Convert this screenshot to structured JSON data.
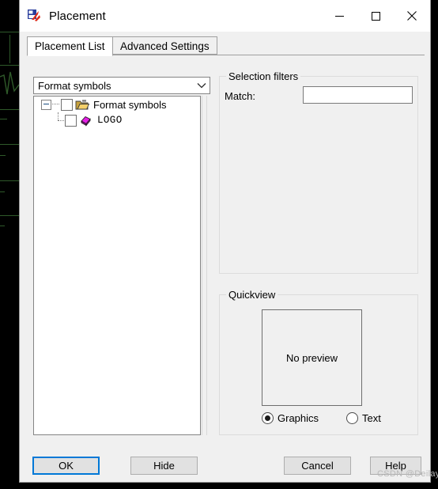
{
  "window": {
    "title": "Placement",
    "icon": "placement-app-icon",
    "controls": {
      "minimize": "minimize-icon",
      "maximize": "maximize-icon",
      "close": "close-icon"
    }
  },
  "tabs": [
    {
      "label": "Placement List",
      "active": true
    },
    {
      "label": "Advanced Settings",
      "active": false
    }
  ],
  "left_panel": {
    "combo": {
      "value": "Format symbols",
      "arrow_icon": "chevron-down-icon"
    },
    "tree": [
      {
        "label": "Format symbols",
        "level": 0,
        "icon": "open-folder-icon",
        "checked": false,
        "expanded": true
      },
      {
        "label": "LOGO",
        "level": 1,
        "icon": "magenta-diamond-icon",
        "checked": false,
        "expanded": null
      }
    ]
  },
  "selection_filters": {
    "title": "Selection filters",
    "match_label": "Match:",
    "match_value": "",
    "match_placeholder": ""
  },
  "quickview": {
    "title": "Quickview",
    "preview_text": "No preview",
    "options": [
      {
        "label": "Graphics",
        "selected": true
      },
      {
        "label": "Text",
        "selected": false
      }
    ]
  },
  "footer": {
    "buttons": [
      {
        "label": "OK",
        "id": "btn-ok",
        "default": true
      },
      {
        "label": "Hide",
        "id": "btn-hide",
        "default": false
      },
      {
        "label": "Cancel",
        "id": "btn-cancel",
        "default": false
      },
      {
        "label": "Help",
        "id": "btn-help",
        "default": false
      }
    ]
  },
  "watermark": "CSDN @Deilay",
  "colors": {
    "accent": "#0078d7",
    "dialog_bg": "#f0f0f0",
    "titlebar_bg": "#ffffff",
    "field_bg": "#ffffff",
    "logo_diamond": "#e61ee6",
    "folder": "#f4d06a",
    "cad_background": "#000000",
    "cad_lines": "#2f5a2a"
  }
}
